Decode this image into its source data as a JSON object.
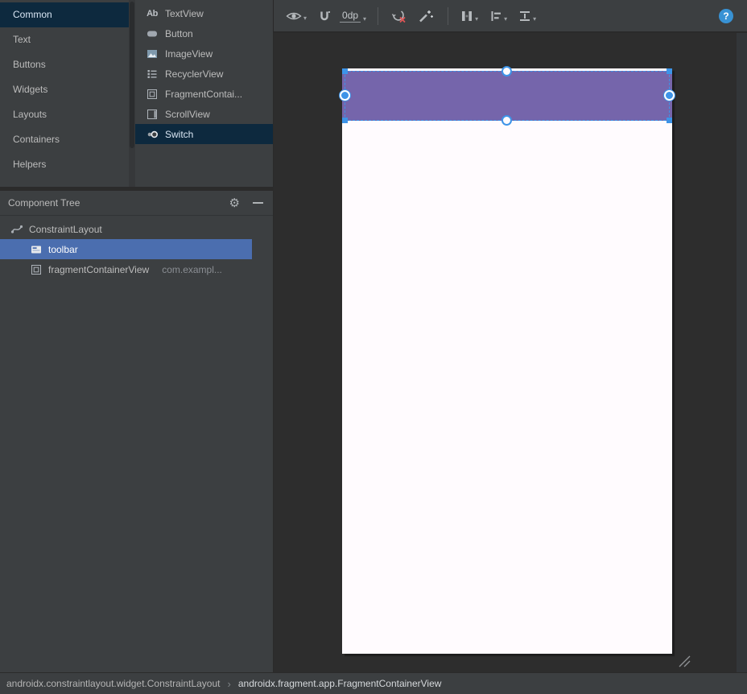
{
  "colors": {
    "bg": "#2b2b2b",
    "panel": "#3c3f41",
    "canvas": "#2d2d2d",
    "palette-selection": "#0d293e",
    "tree-selection": "#4b6eaf",
    "selection-blue": "#3d94e8",
    "toolbar-purple": "#7565ab",
    "phone-bg": "#fffbfe",
    "help-blue": "#3892d4"
  },
  "icons": {
    "gear": "⚙",
    "caret": "▾"
  },
  "palette": {
    "categories": [
      {
        "label": "Common",
        "selected": true
      },
      {
        "label": "Text",
        "selected": false
      },
      {
        "label": "Buttons",
        "selected": false
      },
      {
        "label": "Widgets",
        "selected": false
      },
      {
        "label": "Layouts",
        "selected": false
      },
      {
        "label": "Containers",
        "selected": false
      },
      {
        "label": "Helpers",
        "selected": false
      }
    ],
    "components": [
      {
        "label": "TextView",
        "icon": "textview-icon",
        "icon_text": "Ab",
        "selected": false
      },
      {
        "label": "Button",
        "icon": "button-icon",
        "selected": false
      },
      {
        "label": "ImageView",
        "icon": "imageview-icon",
        "selected": false
      },
      {
        "label": "RecyclerView",
        "icon": "recyclerview-icon",
        "selected": false
      },
      {
        "label": "FragmentContai...",
        "icon": "fragment-container-icon",
        "selected": false
      },
      {
        "label": "ScrollView",
        "icon": "scrollview-icon",
        "selected": false
      },
      {
        "label": "Switch",
        "icon": "switch-icon",
        "selected": true
      }
    ]
  },
  "component_tree": {
    "title": "Component Tree",
    "items": [
      {
        "label": "ConstraintLayout",
        "icon": "constraintlayout-icon",
        "depth": 0,
        "selected": false
      },
      {
        "label": "toolbar",
        "icon": "toolbar-widget-icon",
        "depth": 1,
        "selected": true
      },
      {
        "label": "fragmentContainerView",
        "suffix": "com.exampl...",
        "icon": "fragment-container-icon",
        "depth": 1,
        "selected": false
      }
    ]
  },
  "design_toolbar": {
    "margin_value": "0dp",
    "help_label": "?"
  },
  "statusbar": {
    "separator": "›",
    "crumbs": [
      "androidx.constraintlayout.widget.ConstraintLayout",
      "androidx.fragment.app.FragmentContainerView"
    ]
  }
}
